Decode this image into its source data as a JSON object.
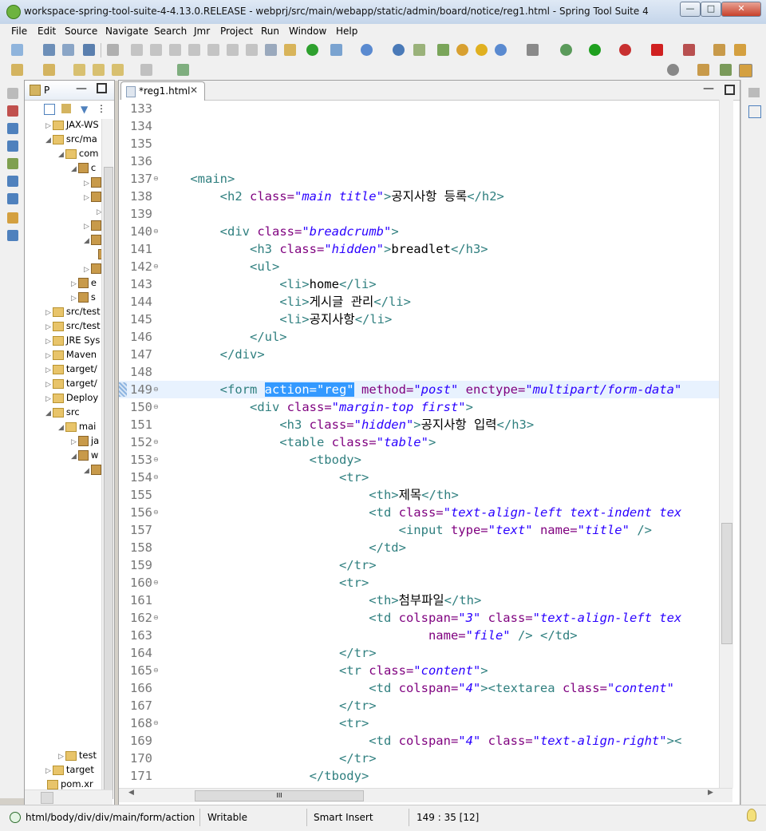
{
  "window": {
    "title": "workspace-spring-tool-suite-4-4.13.0.RELEASE - webprj/src/main/webapp/static/admin/board/notice/reg1.html - Spring Tool Suite 4",
    "minimize": "—",
    "maximize": "□",
    "close": "✕"
  },
  "menu": [
    "File",
    "Edit",
    "Source",
    "Navigate",
    "Search",
    "Jmr",
    "Project",
    "Run",
    "Window",
    "Help"
  ],
  "explorer": {
    "tab_label": "P",
    "tree": [
      {
        "label": "JAX-WS",
        "indent": 0,
        "arrow": "▷"
      },
      {
        "label": "src/ma",
        "indent": 0,
        "arrow": "◢"
      },
      {
        "label": "com",
        "indent": 1,
        "arrow": "◢"
      },
      {
        "label": "c",
        "indent": 2,
        "arrow": "◢"
      },
      {
        "label": "",
        "indent": 3,
        "arrow": "▷"
      },
      {
        "label": "",
        "indent": 3,
        "arrow": "▷"
      },
      {
        "label": "",
        "indent": 4,
        "arrow": "▷"
      },
      {
        "label": "",
        "indent": 3,
        "arrow": "▷"
      },
      {
        "label": "",
        "indent": 3,
        "arrow": "◢"
      },
      {
        "label": "",
        "indent": 4,
        "arrow": ""
      },
      {
        "label": "",
        "indent": 3,
        "arrow": "▷"
      },
      {
        "label": "e",
        "indent": 2,
        "arrow": "▷"
      },
      {
        "label": "s",
        "indent": 2,
        "arrow": "▷"
      },
      {
        "label": "src/test",
        "indent": 0,
        "arrow": "▷"
      },
      {
        "label": "src/test",
        "indent": 0,
        "arrow": "▷"
      },
      {
        "label": "JRE Sys",
        "indent": 0,
        "arrow": "▷"
      },
      {
        "label": "Maven",
        "indent": 0,
        "arrow": "▷"
      },
      {
        "label": "target/",
        "indent": 0,
        "arrow": "▷"
      },
      {
        "label": "target/",
        "indent": 0,
        "arrow": "▷"
      },
      {
        "label": "Deploy",
        "indent": 0,
        "arrow": "▷"
      },
      {
        "label": "src",
        "indent": 0,
        "arrow": "◢"
      },
      {
        "label": "mai",
        "indent": 1,
        "arrow": "◢"
      },
      {
        "label": "ja",
        "indent": 2,
        "arrow": "▷"
      },
      {
        "label": "w",
        "indent": 2,
        "arrow": "◢"
      },
      {
        "label": "",
        "indent": 3,
        "arrow": "◢"
      }
    ],
    "bottom_tree": [
      {
        "label": "test",
        "indent": 1,
        "arrow": "▷"
      },
      {
        "label": "target",
        "indent": 0,
        "arrow": "▷"
      },
      {
        "label": "pom.xr",
        "indent": 0,
        "arrow": ""
      }
    ]
  },
  "editor": {
    "tab_label": "*reg1.html",
    "tab_close": "✕",
    "lines": [
      {
        "num": "133",
        "fold": "",
        "hl": false,
        "segs": []
      },
      {
        "num": "134",
        "fold": "",
        "hl": false,
        "segs": []
      },
      {
        "num": "135",
        "fold": "",
        "hl": false,
        "segs": []
      },
      {
        "num": "136",
        "fold": "",
        "hl": false,
        "segs": []
      },
      {
        "num": "137",
        "fold": "⊖",
        "hl": false,
        "segs": [
          [
            "tx",
            "    "
          ],
          [
            "tg",
            "<main>"
          ]
        ]
      },
      {
        "num": "138",
        "fold": "",
        "hl": false,
        "segs": [
          [
            "tx",
            "        "
          ],
          [
            "tg",
            "<h2 "
          ],
          [
            "at",
            "class="
          ],
          [
            "av",
            "\"main title\""
          ],
          [
            "tg",
            ">"
          ],
          [
            "tx",
            "공지사항 등록"
          ],
          [
            "tg",
            "</h2>"
          ]
        ]
      },
      {
        "num": "139",
        "fold": "",
        "hl": false,
        "segs": []
      },
      {
        "num": "140",
        "fold": "⊖",
        "hl": false,
        "segs": [
          [
            "tx",
            "        "
          ],
          [
            "tg",
            "<div "
          ],
          [
            "at",
            "class="
          ],
          [
            "av",
            "\"breadcrumb\""
          ],
          [
            "tg",
            ">"
          ]
        ]
      },
      {
        "num": "141",
        "fold": "",
        "hl": false,
        "segs": [
          [
            "tx",
            "            "
          ],
          [
            "tg",
            "<h3 "
          ],
          [
            "at",
            "class="
          ],
          [
            "av",
            "\"hidden\""
          ],
          [
            "tg",
            ">"
          ],
          [
            "tx",
            "breadlet"
          ],
          [
            "tg",
            "</h3>"
          ]
        ]
      },
      {
        "num": "142",
        "fold": "⊖",
        "hl": false,
        "segs": [
          [
            "tx",
            "            "
          ],
          [
            "tg",
            "<ul>"
          ]
        ]
      },
      {
        "num": "143",
        "fold": "",
        "hl": false,
        "segs": [
          [
            "tx",
            "                "
          ],
          [
            "tg",
            "<li>"
          ],
          [
            "tx",
            "home"
          ],
          [
            "tg",
            "</li>"
          ]
        ]
      },
      {
        "num": "144",
        "fold": "",
        "hl": false,
        "segs": [
          [
            "tx",
            "                "
          ],
          [
            "tg",
            "<li>"
          ],
          [
            "tx",
            "게시글 관리"
          ],
          [
            "tg",
            "</li>"
          ]
        ]
      },
      {
        "num": "145",
        "fold": "",
        "hl": false,
        "segs": [
          [
            "tx",
            "                "
          ],
          [
            "tg",
            "<li>"
          ],
          [
            "tx",
            "공지사항"
          ],
          [
            "tg",
            "</li>"
          ]
        ]
      },
      {
        "num": "146",
        "fold": "",
        "hl": false,
        "segs": [
          [
            "tx",
            "            "
          ],
          [
            "tg",
            "</ul>"
          ]
        ]
      },
      {
        "num": "147",
        "fold": "",
        "hl": false,
        "segs": [
          [
            "tx",
            "        "
          ],
          [
            "tg",
            "</div>"
          ]
        ]
      },
      {
        "num": "148",
        "fold": "",
        "hl": false,
        "segs": []
      },
      {
        "num": "149",
        "fold": "⊖",
        "hl": true,
        "segs": [
          [
            "tx",
            "        "
          ],
          [
            "tg",
            "<form "
          ],
          [
            "sel",
            "action=\"reg\""
          ],
          [
            "tx",
            " "
          ],
          [
            "at",
            "method="
          ],
          [
            "av",
            "\"post\""
          ],
          [
            "tx",
            " "
          ],
          [
            "at",
            "enctype="
          ],
          [
            "av",
            "\"multipart/form-data\""
          ]
        ]
      },
      {
        "num": "150",
        "fold": "⊖",
        "hl": false,
        "segs": [
          [
            "tx",
            "            "
          ],
          [
            "tg",
            "<div "
          ],
          [
            "at",
            "class="
          ],
          [
            "av",
            "\"margin-top first\""
          ],
          [
            "tg",
            ">"
          ]
        ]
      },
      {
        "num": "151",
        "fold": "",
        "hl": false,
        "segs": [
          [
            "tx",
            "                "
          ],
          [
            "tg",
            "<h3 "
          ],
          [
            "at",
            "class="
          ],
          [
            "av",
            "\"hidden\""
          ],
          [
            "tg",
            ">"
          ],
          [
            "tx",
            "공지사항 입력"
          ],
          [
            "tg",
            "</h3>"
          ]
        ]
      },
      {
        "num": "152",
        "fold": "⊖",
        "hl": false,
        "segs": [
          [
            "tx",
            "                "
          ],
          [
            "tg",
            "<table "
          ],
          [
            "at",
            "class="
          ],
          [
            "av",
            "\"table\""
          ],
          [
            "tg",
            ">"
          ]
        ]
      },
      {
        "num": "153",
        "fold": "⊖",
        "hl": false,
        "segs": [
          [
            "tx",
            "                    "
          ],
          [
            "tg",
            "<tbody>"
          ]
        ]
      },
      {
        "num": "154",
        "fold": "⊖",
        "hl": false,
        "segs": [
          [
            "tx",
            "                        "
          ],
          [
            "tg",
            "<tr>"
          ]
        ]
      },
      {
        "num": "155",
        "fold": "",
        "hl": false,
        "segs": [
          [
            "tx",
            "                            "
          ],
          [
            "tg",
            "<th>"
          ],
          [
            "tx",
            "제목"
          ],
          [
            "tg",
            "</th>"
          ]
        ]
      },
      {
        "num": "156",
        "fold": "⊖",
        "hl": false,
        "segs": [
          [
            "tx",
            "                            "
          ],
          [
            "tg",
            "<td "
          ],
          [
            "at",
            "class="
          ],
          [
            "av",
            "\"text-align-left text-indent tex"
          ]
        ]
      },
      {
        "num": "157",
        "fold": "",
        "hl": false,
        "segs": [
          [
            "tx",
            "                                "
          ],
          [
            "tg",
            "<input "
          ],
          [
            "at",
            "type="
          ],
          [
            "av",
            "\"text\""
          ],
          [
            "tx",
            " "
          ],
          [
            "at",
            "name="
          ],
          [
            "av",
            "\"title\""
          ],
          [
            "tx",
            " "
          ],
          [
            "tg",
            "/>"
          ]
        ]
      },
      {
        "num": "158",
        "fold": "",
        "hl": false,
        "segs": [
          [
            "tx",
            "                            "
          ],
          [
            "tg",
            "</td>"
          ]
        ]
      },
      {
        "num": "159",
        "fold": "",
        "hl": false,
        "segs": [
          [
            "tx",
            "                        "
          ],
          [
            "tg",
            "</tr>"
          ]
        ]
      },
      {
        "num": "160",
        "fold": "⊖",
        "hl": false,
        "segs": [
          [
            "tx",
            "                        "
          ],
          [
            "tg",
            "<tr>"
          ]
        ]
      },
      {
        "num": "161",
        "fold": "",
        "hl": false,
        "segs": [
          [
            "tx",
            "                            "
          ],
          [
            "tg",
            "<th>"
          ],
          [
            "tx",
            "첨부파일"
          ],
          [
            "tg",
            "</th>"
          ]
        ]
      },
      {
        "num": "162",
        "fold": "⊖",
        "hl": false,
        "segs": [
          [
            "tx",
            "                            "
          ],
          [
            "tg",
            "<td "
          ],
          [
            "at",
            "colspan="
          ],
          [
            "av",
            "\"3\""
          ],
          [
            "tx",
            " "
          ],
          [
            "at",
            "class="
          ],
          [
            "av",
            "\"text-align-left tex"
          ]
        ]
      },
      {
        "num": "163",
        "fold": "",
        "hl": false,
        "segs": [
          [
            "tx",
            "                                    "
          ],
          [
            "at",
            "name="
          ],
          [
            "av",
            "\"file\""
          ],
          [
            "tx",
            " "
          ],
          [
            "tg",
            "/>"
          ],
          [
            "tx",
            " "
          ],
          [
            "tg",
            "</td>"
          ]
        ]
      },
      {
        "num": "164",
        "fold": "",
        "hl": false,
        "segs": [
          [
            "tx",
            "                        "
          ],
          [
            "tg",
            "</tr>"
          ]
        ]
      },
      {
        "num": "165",
        "fold": "⊖",
        "hl": false,
        "segs": [
          [
            "tx",
            "                        "
          ],
          [
            "tg",
            "<tr "
          ],
          [
            "at",
            "class="
          ],
          [
            "av",
            "\"content\""
          ],
          [
            "tg",
            ">"
          ]
        ]
      },
      {
        "num": "166",
        "fold": "",
        "hl": false,
        "segs": [
          [
            "tx",
            "                            "
          ],
          [
            "tg",
            "<td "
          ],
          [
            "at",
            "colspan="
          ],
          [
            "av",
            "\"4\""
          ],
          [
            "tg",
            "><textarea "
          ],
          [
            "at",
            "class="
          ],
          [
            "av",
            "\"content\""
          ]
        ]
      },
      {
        "num": "167",
        "fold": "",
        "hl": false,
        "segs": [
          [
            "tx",
            "                        "
          ],
          [
            "tg",
            "</tr>"
          ]
        ]
      },
      {
        "num": "168",
        "fold": "⊖",
        "hl": false,
        "segs": [
          [
            "tx",
            "                        "
          ],
          [
            "tg",
            "<tr>"
          ]
        ]
      },
      {
        "num": "169",
        "fold": "",
        "hl": false,
        "segs": [
          [
            "tx",
            "                            "
          ],
          [
            "tg",
            "<td "
          ],
          [
            "at",
            "colspan="
          ],
          [
            "av",
            "\"4\""
          ],
          [
            "tx",
            " "
          ],
          [
            "at",
            "class="
          ],
          [
            "av",
            "\"text-align-right\""
          ],
          [
            "tg",
            "><"
          ]
        ]
      },
      {
        "num": "170",
        "fold": "",
        "hl": false,
        "segs": [
          [
            "tx",
            "                        "
          ],
          [
            "tg",
            "</tr>"
          ]
        ]
      },
      {
        "num": "171",
        "fold": "",
        "hl": false,
        "segs": [
          [
            "tx",
            "                    "
          ],
          [
            "tg",
            "</tbody>"
          ]
        ]
      }
    ],
    "hscroll_grip": "III"
  },
  "status": {
    "path": "html/body/div/div/main/form/action",
    "mode": "Writable",
    "insert": "Smart Insert",
    "position": "149 : 35 [12]"
  },
  "colors": {
    "tag": "#2f7f7f",
    "attr_name": "#7f007f",
    "attr_value": "#2a00ff",
    "selection": "#3399ff",
    "current_line": "#e8f2fe"
  }
}
